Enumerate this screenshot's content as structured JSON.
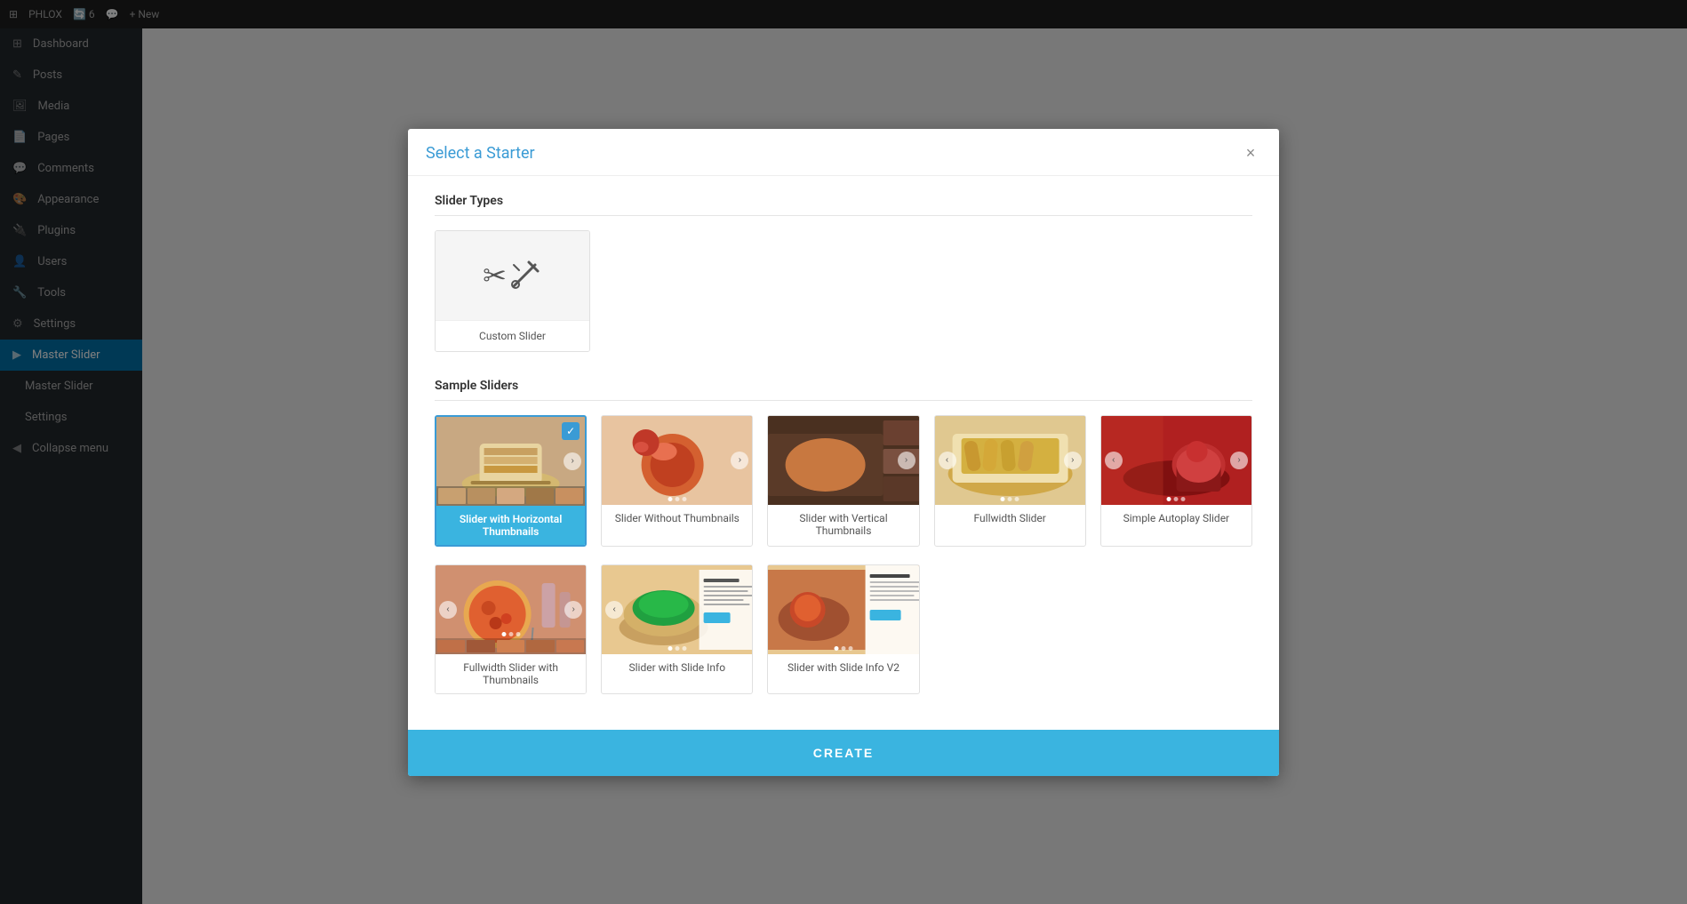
{
  "topbar": {
    "items": [
      "WordPress icon",
      "PHLOX",
      "6 updates",
      "comments",
      "+ New"
    ]
  },
  "sidebar": {
    "items": [
      {
        "label": "Dashboard",
        "icon": "⊞"
      },
      {
        "label": "Posts",
        "icon": "✎"
      },
      {
        "label": "Media",
        "icon": "🖼"
      },
      {
        "label": "Pages",
        "icon": "📄"
      },
      {
        "label": "Comments",
        "icon": "💬"
      },
      {
        "label": "Appearance",
        "icon": "🎨"
      },
      {
        "label": "Plugins",
        "icon": "🔌"
      },
      {
        "label": "Users",
        "icon": "👤"
      },
      {
        "label": "Tools",
        "icon": "🔧"
      },
      {
        "label": "Settings",
        "icon": "⚙"
      },
      {
        "label": "Master Slider",
        "icon": "▶",
        "active": true
      },
      {
        "label": "Master Slider",
        "icon": ""
      },
      {
        "label": "Settings",
        "icon": ""
      },
      {
        "label": "Collapse menu",
        "icon": "◀"
      }
    ]
  },
  "modal": {
    "title": "Select a Starter",
    "close_label": "×",
    "sections": {
      "slider_types": {
        "label": "Slider Types",
        "items": [
          {
            "id": "custom",
            "label": "Custom Slider",
            "icon": "wrench"
          }
        ]
      },
      "sample_sliders": {
        "label": "Sample Sliders",
        "row1": [
          {
            "id": "horizontal-thumbs",
            "label": "Slider with Horizontal Thumbnails",
            "selected": true,
            "food": "food-1"
          },
          {
            "id": "no-thumbs",
            "label": "Slider Without Thumbnails",
            "food": "food-2"
          },
          {
            "id": "vertical-thumbs",
            "label": "Slider with Vertical Thumbnails",
            "food": "food-3"
          },
          {
            "id": "fullwidth",
            "label": "Fullwidth Slider",
            "food": "food-4"
          },
          {
            "id": "autoplay",
            "label": "Simple Autoplay Slider",
            "food": "food-5"
          }
        ],
        "row2": [
          {
            "id": "fullwidth-thumbs",
            "label": "Fullwidth Slider with Thumbnails",
            "food": "food-6"
          },
          {
            "id": "slide-info",
            "label": "Slider with Slide Info",
            "food": "food-7"
          },
          {
            "id": "slide-info-v2",
            "label": "Slider with Slide Info V2",
            "food": "food-8"
          },
          {
            "id": "empty1",
            "label": "",
            "empty": true
          },
          {
            "id": "empty2",
            "label": "",
            "empty": true
          }
        ]
      }
    },
    "footer": {
      "create_label": "CREATE"
    }
  }
}
